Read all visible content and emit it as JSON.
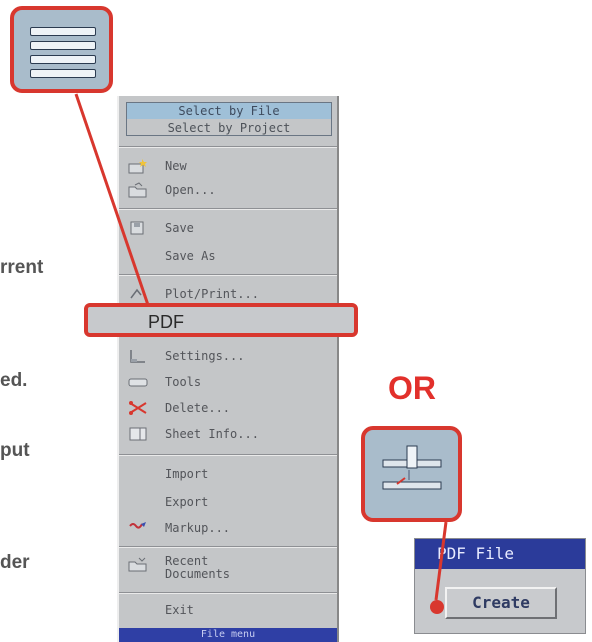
{
  "doc_fragments": [
    "rrent",
    "ed.",
    "put",
    "der"
  ],
  "menu": {
    "select_by_file": "Select by File",
    "select_by_project": "Select by Project",
    "items": {
      "new": "New",
      "open": "Open...",
      "save": "Save",
      "save_as": "Save As",
      "plot_print": "Plot/Print...",
      "settings": "Settings...",
      "tools": "Tools",
      "delete": "Delete...",
      "sheet_info": "Sheet Info...",
      "import": "Import",
      "export": "Export",
      "markup": "Markup...",
      "recent_documents": "Recent Documents",
      "exit": "Exit"
    },
    "footer": "File menu"
  },
  "pdf_highlight_label": "PDF",
  "or_label": "OR",
  "pdf_file_panel": {
    "title": "PDF File",
    "create_label": "Create"
  },
  "colors": {
    "highlight": "#d8372e",
    "menu_bg": "#c4c6c8",
    "title_bar": "#2b3b9a",
    "icon_bg": "#a9bccb"
  },
  "icons": {
    "toolbar_menu": "menu-lines-icon",
    "toolbar_pdf": "pdf-file-toolbar-icon",
    "new": "new-file-icon",
    "open": "open-folder-icon",
    "save": "save-disk-icon",
    "plot": "plot-print-icon",
    "settings": "settings-icon",
    "tools": "tools-icon",
    "delete": "scissors-icon",
    "sheet_info": "sheet-info-icon",
    "markup": "markup-pen-icon",
    "recent": "recent-folder-icon"
  }
}
